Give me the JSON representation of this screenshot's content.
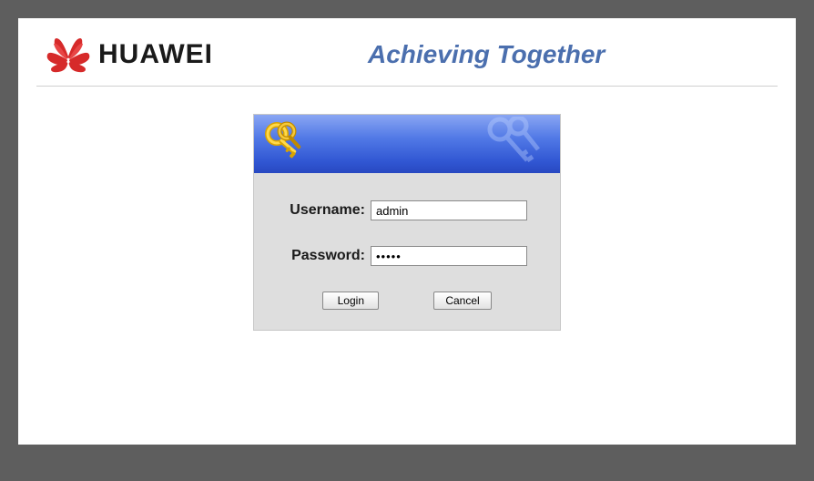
{
  "header": {
    "brand_name": "HUAWEI",
    "tagline": "Achieving Together"
  },
  "login": {
    "username_label": "Username:",
    "password_label": "Password:",
    "username_value": "admin",
    "password_value": "•••••",
    "login_button": "Login",
    "cancel_button": "Cancel"
  }
}
